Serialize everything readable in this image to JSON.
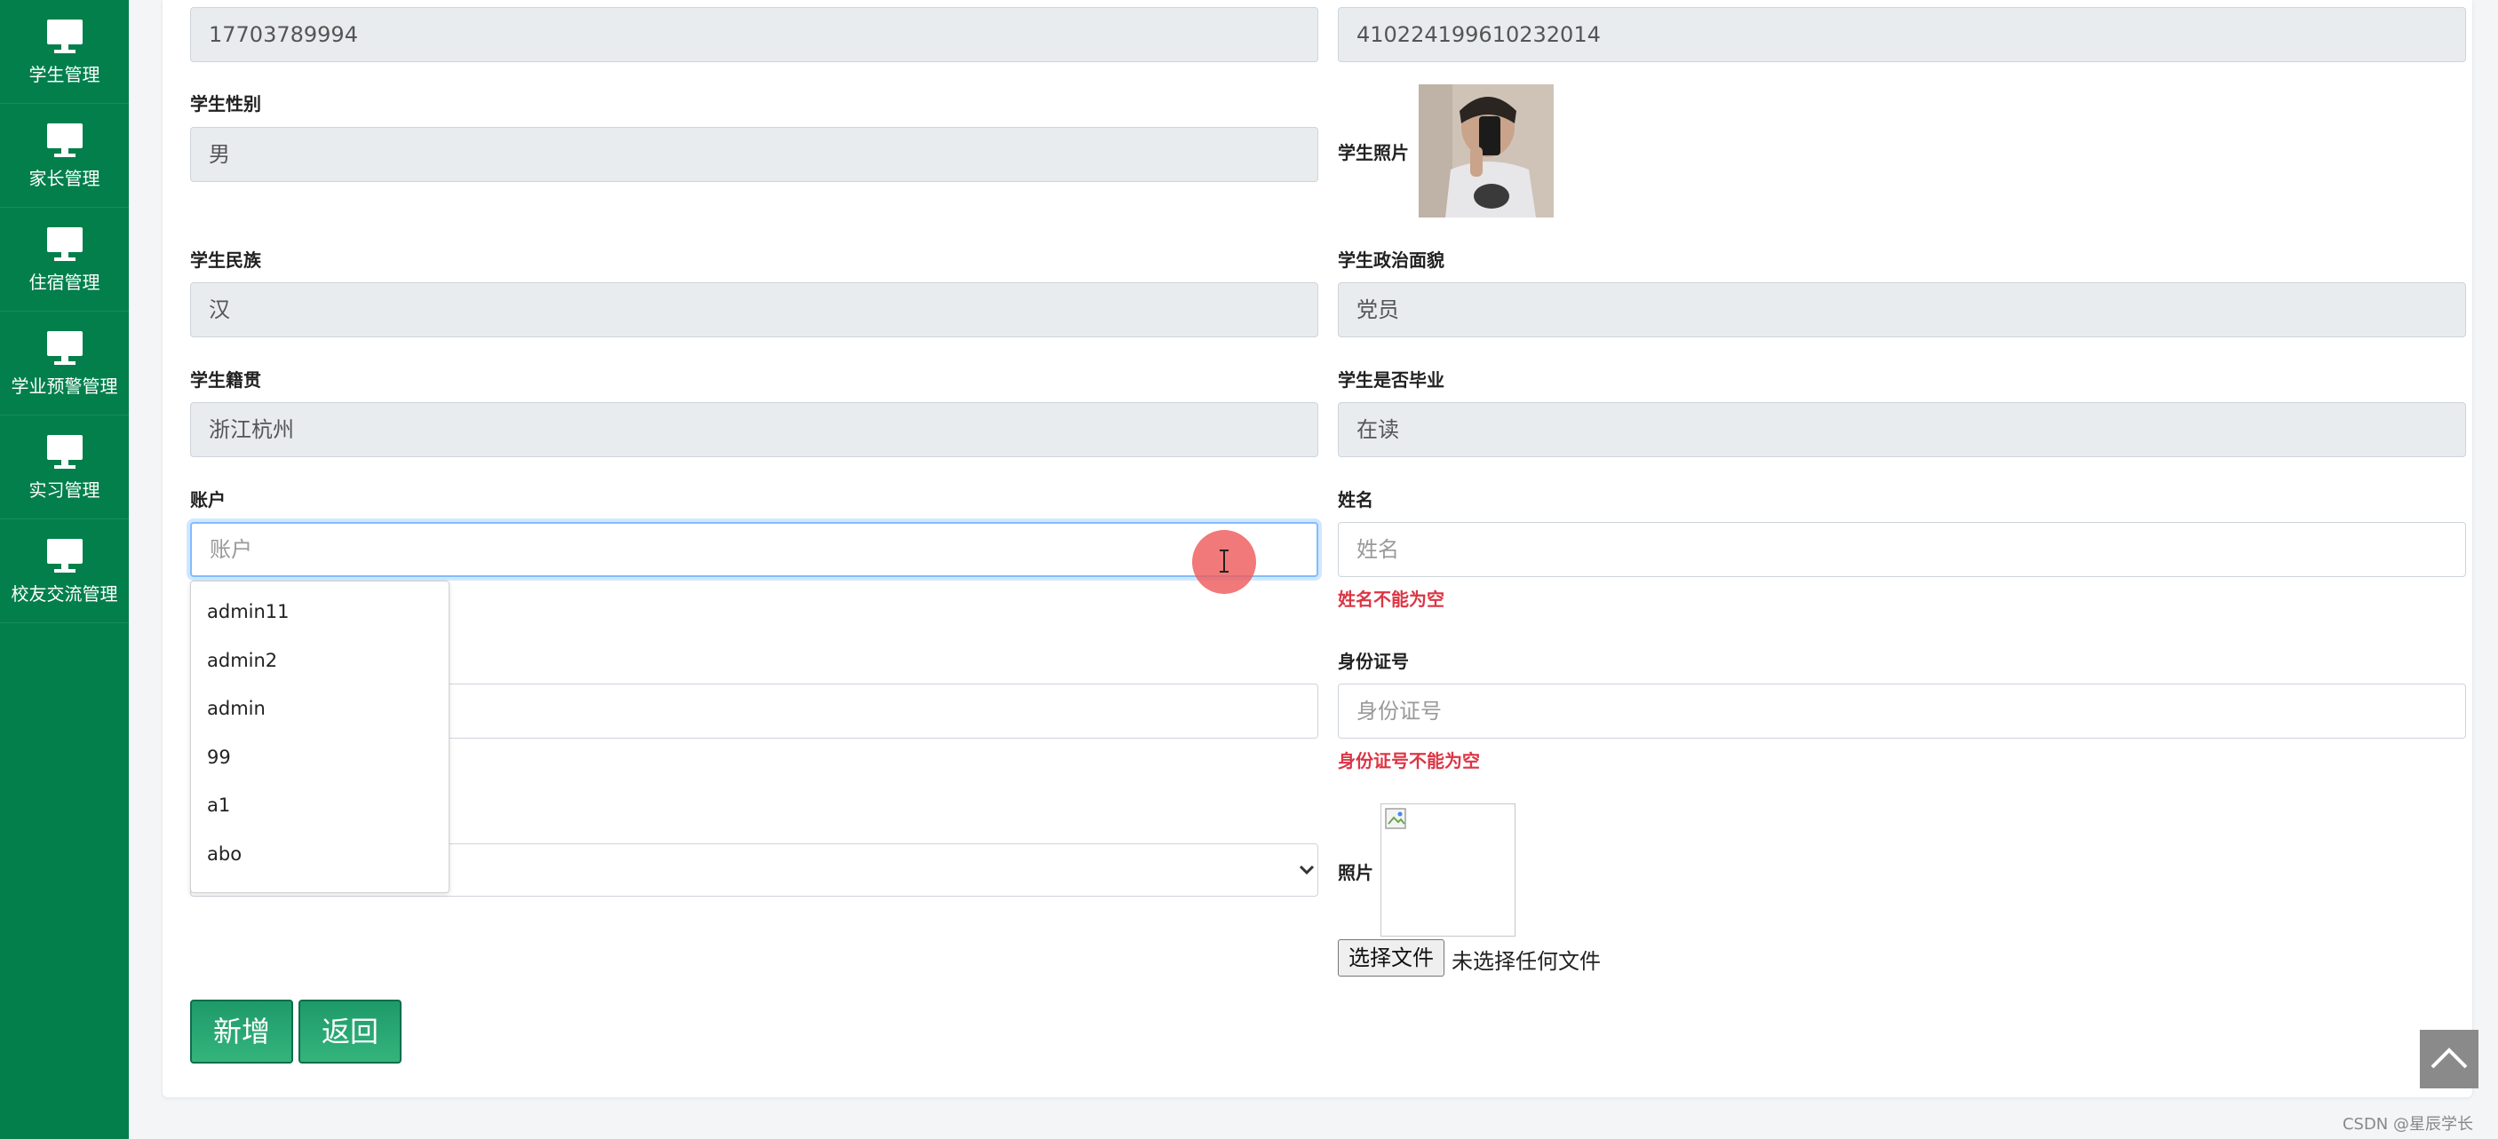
{
  "sidebar": {
    "items": [
      {
        "label": "学生管理"
      },
      {
        "label": "家长管理"
      },
      {
        "label": "住宿管理"
      },
      {
        "label": "学业预警管理"
      },
      {
        "label": "实习管理"
      },
      {
        "label": "校友交流管理"
      }
    ]
  },
  "form": {
    "phone": {
      "value": "17703789994"
    },
    "idcard_top": {
      "value": "410224199610232014"
    },
    "gender": {
      "label": "学生性别",
      "value": "男"
    },
    "photo": {
      "label": "学生照片"
    },
    "ethnicity": {
      "label": "学生民族",
      "value": "汉"
    },
    "political": {
      "label": "学生政治面貌",
      "value": "党员"
    },
    "origin": {
      "label": "学生籍贯",
      "value": "浙江杭州"
    },
    "graduated": {
      "label": "学生是否毕业",
      "value": "在读"
    },
    "account": {
      "label": "账户",
      "placeholder": "账户"
    },
    "name": {
      "label": "姓名",
      "placeholder": "姓名",
      "error": "姓名不能为空"
    },
    "idcard": {
      "label": "身份证号",
      "placeholder": "身份证号",
      "error": "身份证号不能为空"
    },
    "upload": {
      "label": "照片",
      "button": "选择文件",
      "status": "未选择任何文件"
    }
  },
  "autocomplete": {
    "options": [
      "admin11",
      "admin2",
      "admin",
      "99",
      "a1",
      "abo"
    ]
  },
  "buttons": {
    "add": "新增",
    "back": "返回"
  },
  "watermark": "CSDN @星辰学长",
  "colors": {
    "sidebar": "#037f4c",
    "button": "#1e9a6a",
    "error": "#dc3545",
    "focus": "#80bdff"
  }
}
